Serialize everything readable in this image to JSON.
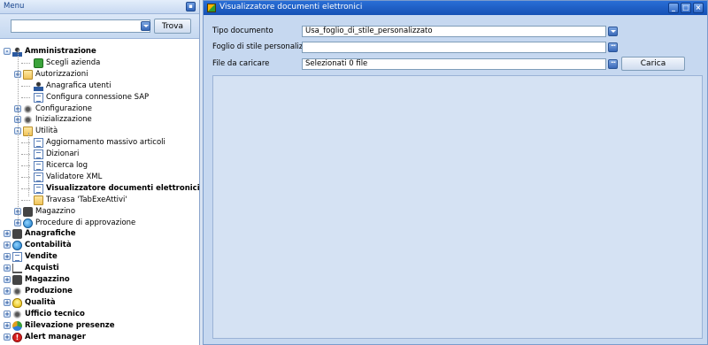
{
  "menu": {
    "title": "Menu",
    "search_value": "",
    "search_button": "Trova"
  },
  "tree": [
    {
      "label": "Amministrazione",
      "bold": true,
      "icon": "person-icon",
      "toggle": "-"
    },
    {
      "label": "Scegli azienda",
      "icon": "company-icon"
    },
    {
      "label": "Autorizzazioni",
      "icon": "folder-icon",
      "toggle": "+"
    },
    {
      "label": "Anagrafica utenti",
      "icon": "user-icon"
    },
    {
      "label": "Configura connessione SAP",
      "icon": "doc-icon"
    },
    {
      "label": "Configurazione",
      "icon": "gear-icon",
      "toggle": "+"
    },
    {
      "label": "Inizializzazione",
      "icon": "tools-icon",
      "toggle": "+"
    },
    {
      "label": "Utilità",
      "icon": "folder-icon",
      "toggle": "-"
    },
    {
      "label": "Aggiornamento massivo articoli",
      "icon": "doc-icon"
    },
    {
      "label": "Dizionari",
      "icon": "book-icon"
    },
    {
      "label": "Ricerca log",
      "icon": "doc-icon"
    },
    {
      "label": "Validatore XML",
      "icon": "doc-icon"
    },
    {
      "label": "Visualizzatore documenti elettronici",
      "icon": "doc-icon",
      "selected": true
    },
    {
      "label": "Travasa 'TabExeAttivi'",
      "icon": "transfer-icon"
    },
    {
      "label": "Magazzino",
      "icon": "warehouse-icon",
      "toggle": "+"
    },
    {
      "label": "Procedure di approvazione",
      "icon": "earth-icon",
      "toggle": "+"
    },
    {
      "label": "Anagrafiche",
      "bold": true,
      "icon": "pen-icon",
      "toggle": "+"
    },
    {
      "label": "Contabilità",
      "bold": true,
      "icon": "earth-icon",
      "toggle": "+"
    },
    {
      "label": "Vendite",
      "bold": true,
      "icon": "truck-icon",
      "toggle": "+"
    },
    {
      "label": "Acquisti",
      "bold": true,
      "icon": "cart-icon",
      "toggle": "+"
    },
    {
      "label": "Magazzino",
      "bold": true,
      "icon": "warehouse-icon",
      "toggle": "+"
    },
    {
      "label": "Produzione",
      "bold": true,
      "icon": "gears-icon",
      "toggle": "+"
    },
    {
      "label": "Qualità",
      "bold": true,
      "icon": "bulb-icon",
      "toggle": "+"
    },
    {
      "label": "Ufficio tecnico",
      "bold": true,
      "icon": "compass-icon",
      "toggle": "+"
    },
    {
      "label": "Rilevazione presenze",
      "bold": true,
      "icon": "clock-icon",
      "toggle": "+"
    },
    {
      "label": "Alert manager",
      "bold": true,
      "icon": "warning-icon",
      "toggle": "+"
    }
  ],
  "window": {
    "title": "Visualizzatore documenti elettronici",
    "tipo_documento_label": "Tipo documento",
    "tipo_documento_value": "Usa_foglio_di_stile_personalizzato",
    "foglio_label": "Foglio di stile personalizzato",
    "foglio_value": "",
    "file_label": "File da caricare",
    "file_value": "Selezionati 0 file",
    "carica_button": "Carica"
  }
}
